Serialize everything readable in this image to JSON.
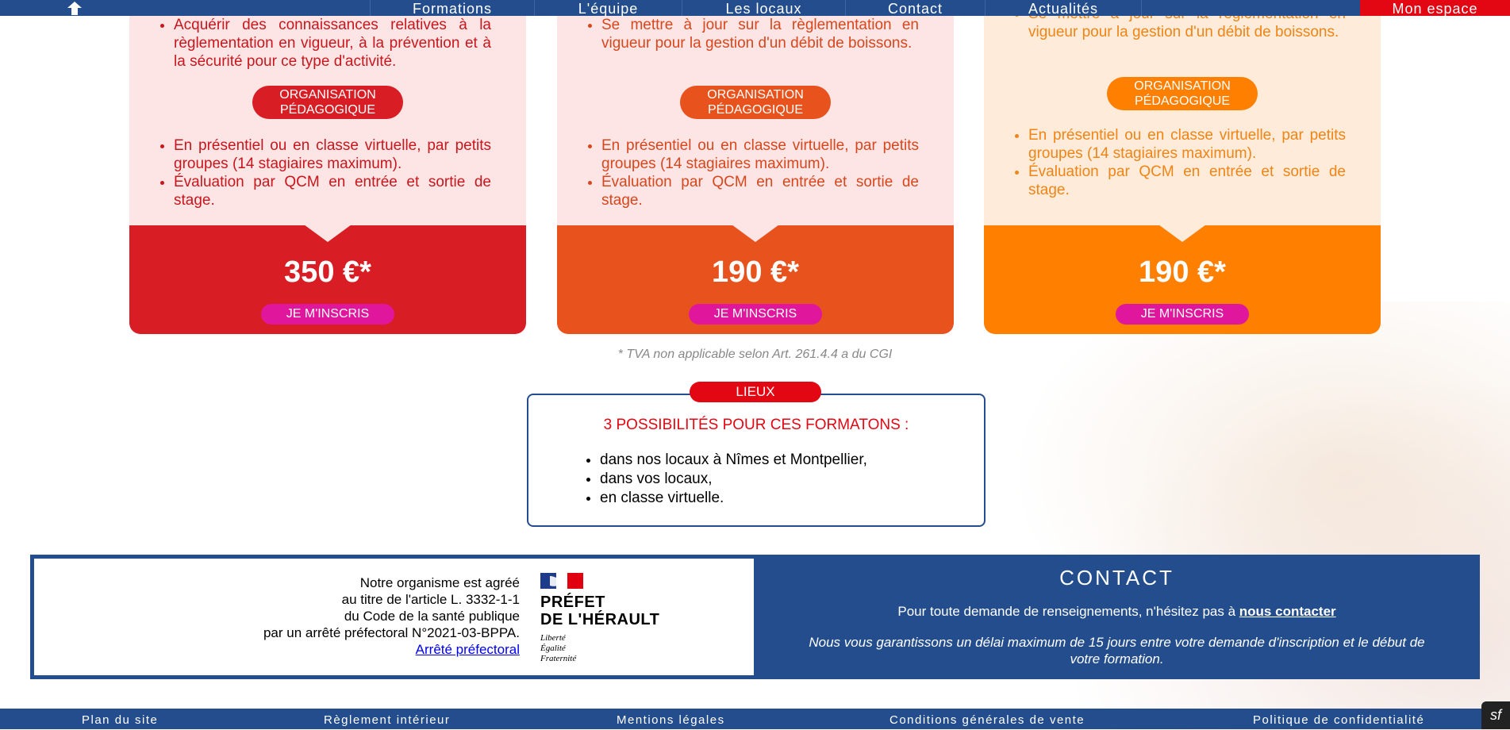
{
  "nav": {
    "items": [
      "Formations",
      "L'équipe",
      "Les locaux",
      "Contact",
      "Actualités"
    ],
    "account": "Mon espace"
  },
  "cards": [
    {
      "bullets_top": [
        "Acquérir des connaissances relatives à la règlementation en vigueur, à la prévention et à la sécurité pour ce type d'activité."
      ],
      "pill_line1": "ORGANISATION",
      "pill_line2": "PÉDAGOGIQUE",
      "bullets_bottom": [
        "En présentiel ou en classe virtuelle, par petits groupes (14 stagiaires maximum).",
        "Évaluation par QCM en entrée et sortie de stage."
      ],
      "price": "350 €*",
      "signup": "JE M'INSCRIS",
      "colors": {
        "upper": "#fde5e5",
        "text": "#c8161d",
        "lower": "#d81e24",
        "pill": "#d81e24"
      }
    },
    {
      "bullets_top": [
        "Se mettre à jour sur la règlementation en vigueur pour la gestion d'un débit de boissons."
      ],
      "pill_line1": "ORGANISATION",
      "pill_line2": "PÉDAGOGIQUE",
      "bullets_bottom": [
        "En présentiel ou en classe virtuelle, par petits groupes (14 stagiaires maximum).",
        "Évaluation par QCM en entrée et sortie de stage."
      ],
      "price": "190 €*",
      "signup": "JE M'INSCRIS",
      "colors": {
        "upper": "#fde5e5",
        "text": "#d8461c",
        "lower": "#e8521d",
        "pill": "#e8521d"
      }
    },
    {
      "bullets_top": [
        "Se mettre à jour sur la règlementation en vigueur pour la gestion d'un débit de boissons."
      ],
      "pill_line1": "ORGANISATION",
      "pill_line2": "PÉDAGOGIQUE",
      "bullets_bottom": [
        "En présentiel ou en classe virtuelle, par petits groupes (14 stagiaires maximum).",
        "Évaluation par QCM en entrée et sortie de stage."
      ],
      "price": "190 €*",
      "signup": "JE M'INSCRIS",
      "colors": {
        "upper": "#feebd9",
        "text": "#f08414",
        "lower": "#ff7f00",
        "pill": "#ff7f00"
      }
    }
  ],
  "tva_note": "* TVA non applicable selon Art. 261.4.4 a du CGI",
  "lieux": {
    "tag": "LIEUX",
    "title": "3 POSSIBILITÉS POUR CES FORMATONS :",
    "items": [
      "dans nos locaux à Nîmes et Montpellier,",
      "dans vos locaux,",
      "en classe virtuelle."
    ]
  },
  "agreement": {
    "lines": [
      "Notre organisme est agréé",
      "au titre de l'article L. 3332-1-1",
      "du Code de la santé publique",
      "par un arrêté préfectoral N°2021-03-BPPA."
    ],
    "link": "Arrêté préfectoral",
    "prefet_line1": "PRÉFET",
    "prefet_line2": "DE L'HÉRAULT",
    "devise": [
      "Liberté",
      "Égalité",
      "Fraternité"
    ]
  },
  "contact": {
    "title": "CONTACT",
    "line_prefix": "Pour toute demande de renseignements, n'hésitez pas à ",
    "link": "nous contacter",
    "note": "Nous vous garantissons un délai maximum de 15 jours entre votre demande d'inscription et le début de votre formation."
  },
  "footer": {
    "items": [
      "Plan du site",
      "Règlement intérieur",
      "Mentions légales",
      "Conditions générales de vente",
      "Politique de confidentialité"
    ]
  },
  "symfony_glyph": "sf"
}
